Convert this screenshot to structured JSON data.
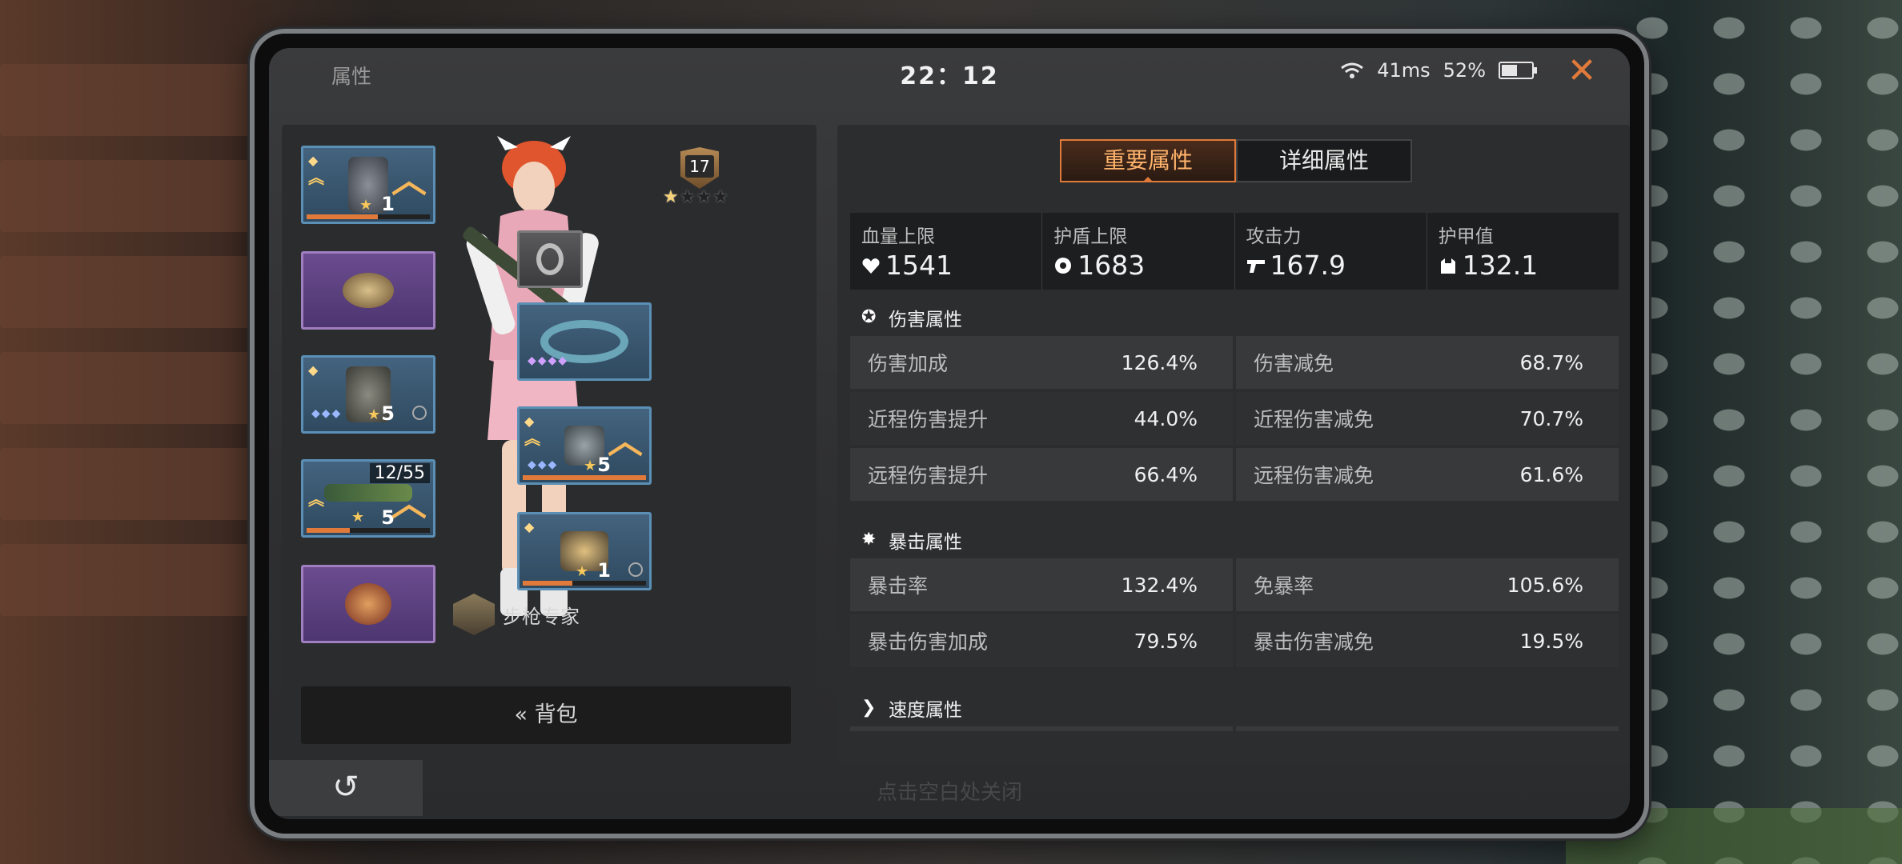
{
  "status": {
    "title": "属性",
    "time": "22：12",
    "ping": "41ms",
    "battery": "52%",
    "battery_level": 0.52
  },
  "left": {
    "rank_level": "17",
    "rank_stars_filled": 1,
    "rank_stars_total": 4,
    "title_badge": "步枪专家",
    "bag_label": "背包",
    "slots": [
      {
        "level": "1",
        "ammo": ""
      },
      {
        "level": "",
        "ammo": ""
      },
      {
        "level": "5",
        "ammo": ""
      },
      {
        "level": "5",
        "ammo": "12/55"
      },
      {
        "level": "",
        "ammo": ""
      },
      {
        "level": "",
        "ammo": ""
      },
      {
        "level": "",
        "ammo": ""
      },
      {
        "level": "5",
        "ammo": ""
      },
      {
        "level": "1",
        "ammo": ""
      }
    ]
  },
  "right": {
    "tabs": [
      "重要属性",
      "详细属性"
    ],
    "active_tab": 0,
    "basic": [
      {
        "label": "血量上限",
        "value": "1541",
        "icon": "heart-icon"
      },
      {
        "label": "护盾上限",
        "value": "1683",
        "icon": "shield-icon"
      },
      {
        "label": "攻击力",
        "value": "167.9",
        "icon": "gun-icon"
      },
      {
        "label": "护甲值",
        "value": "132.1",
        "icon": "armor-icon"
      }
    ],
    "sections": [
      {
        "title": "伤害属性",
        "rows": [
          [
            {
              "k": "伤害加成",
              "v": "126.4%"
            },
            {
              "k": "伤害减免",
              "v": "68.7%"
            }
          ],
          [
            {
              "k": "近程伤害提升",
              "v": "44.0%"
            },
            {
              "k": "近程伤害减免",
              "v": "70.7%"
            }
          ],
          [
            {
              "k": "远程伤害提升",
              "v": "66.4%"
            },
            {
              "k": "远程伤害减免",
              "v": "61.6%"
            }
          ]
        ]
      },
      {
        "title": "暴击属性",
        "rows": [
          [
            {
              "k": "暴击率",
              "v": "132.4%"
            },
            {
              "k": "免暴率",
              "v": "105.6%"
            }
          ],
          [
            {
              "k": "暴击伤害加成",
              "v": "79.5%"
            },
            {
              "k": "暴击伤害减免",
              "v": "19.5%"
            }
          ]
        ]
      },
      {
        "title": "速度属性",
        "rows": []
      }
    ]
  },
  "bottom": {
    "back_icon": "↺",
    "hint": "点击空白处关闭"
  },
  "colors": {
    "accent": "#e07a3a",
    "slot_blue": "#5b8fb5",
    "slot_purple": "#a07fc0"
  }
}
